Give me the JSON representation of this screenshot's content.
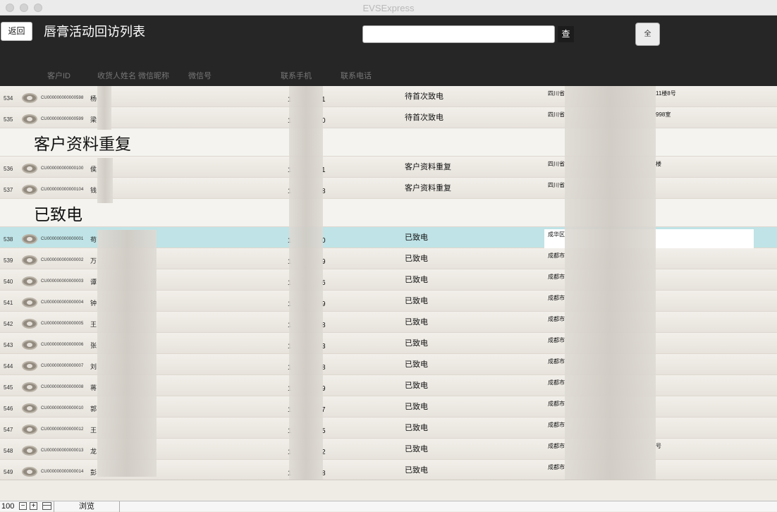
{
  "window": {
    "title": "EVSExpress"
  },
  "header": {
    "back_label": "返回",
    "title": "唇膏活动回访列表",
    "search_value": "",
    "search_label": "查",
    "all_label": "全"
  },
  "columns": [
    "客户ID",
    "收货人姓名",
    "微信昵称",
    "微信号",
    "联系手机",
    "联系电话"
  ],
  "groups": [
    {
      "label": "",
      "rows": [
        {
          "num": "534",
          "cid": "CU000000000000598",
          "name": "杨",
          "phone_a": "1",
          "phone_b": "1",
          "status": "待首次致电",
          "addr_a": "四川省",
          "addr_b": "11楼8号"
        },
        {
          "num": "535",
          "cid": "CU000000000000599",
          "name": "梁",
          "phone_a": "1",
          "phone_b": "0",
          "status": "待首次致电",
          "addr_a": "四川省",
          "addr_b": "998室"
        }
      ]
    },
    {
      "label": "客户资料重复",
      "rows": [
        {
          "num": "536",
          "cid": "CU000000000000100",
          "name": "侯",
          "phone_a": "1",
          "phone_b": "1",
          "status": "客户资料重复",
          "addr_a": "四川省",
          "addr_b": "楼"
        },
        {
          "num": "537",
          "cid": "CU000000000000104",
          "name": "钱",
          "phone_a": "1",
          "phone_b": "8",
          "status": "客户资料重复",
          "addr_a": "四川省",
          "addr_b": ""
        }
      ]
    },
    {
      "label": "已致电",
      "rows": [
        {
          "num": "538",
          "cid": "CU000000000000001",
          "name": "苟",
          "phone_a": "1",
          "phone_b": "0",
          "status": "已致电",
          "addr_a": "成华区",
          "addr_b": "",
          "selected": true
        },
        {
          "num": "539",
          "cid": "CU000000000000002",
          "name": "万",
          "phone_a": "1",
          "phone_b": "9",
          "status": "已致电",
          "addr_a": "成都市",
          "addr_b": ""
        },
        {
          "num": "540",
          "cid": "CU000000000000003",
          "name": "谭",
          "phone_a": "1",
          "phone_b": "6",
          "status": "已致电",
          "addr_a": "成都市",
          "addr_b": ""
        },
        {
          "num": "541",
          "cid": "CU000000000000004",
          "name": "钟",
          "phone_a": "1",
          "phone_b": "9",
          "status": "已致电",
          "addr_a": "成都市",
          "addr_b": ""
        },
        {
          "num": "542",
          "cid": "CU000000000000005",
          "name": "王",
          "phone_a": "1",
          "phone_b": "8",
          "status": "已致电",
          "addr_a": "成都市",
          "addr_b": ""
        },
        {
          "num": "543",
          "cid": "CU000000000000006",
          "name": "张",
          "phone_a": "1",
          "phone_b": "3",
          "status": "已致电",
          "addr_a": "成都市",
          "addr_b": ""
        },
        {
          "num": "544",
          "cid": "CU000000000000007",
          "name": "刘",
          "phone_a": "1",
          "phone_b": "8",
          "status": "已致电",
          "addr_a": "成都市",
          "addr_b": ""
        },
        {
          "num": "545",
          "cid": "CU000000000000008",
          "name": "蒋",
          "phone_a": "1",
          "phone_b": "9",
          "status": "已致电",
          "addr_a": "成都市",
          "addr_b": ""
        },
        {
          "num": "546",
          "cid": "CU000000000000010",
          "name": "郭",
          "phone_a": "1",
          "phone_b": "7",
          "status": "已致电",
          "addr_a": "成都市",
          "addr_b": ""
        },
        {
          "num": "547",
          "cid": "CU000000000000012",
          "name": "王",
          "phone_a": "1",
          "phone_b": "5",
          "status": "已致电",
          "addr_a": "成都市",
          "addr_b": ""
        },
        {
          "num": "548",
          "cid": "CU000000000000013",
          "name": "龙",
          "phone_a": "1",
          "phone_b": "2",
          "status": "已致电",
          "addr_a": "成都市",
          "addr_b": "号"
        },
        {
          "num": "549",
          "cid": "CU000000000000014",
          "name": "彭",
          "phone_a": "1",
          "phone_b": "8",
          "status": "已致电",
          "addr_a": "成都市",
          "addr_b": ""
        }
      ]
    }
  ],
  "statusbar": {
    "count": "100",
    "mode": "浏览"
  }
}
